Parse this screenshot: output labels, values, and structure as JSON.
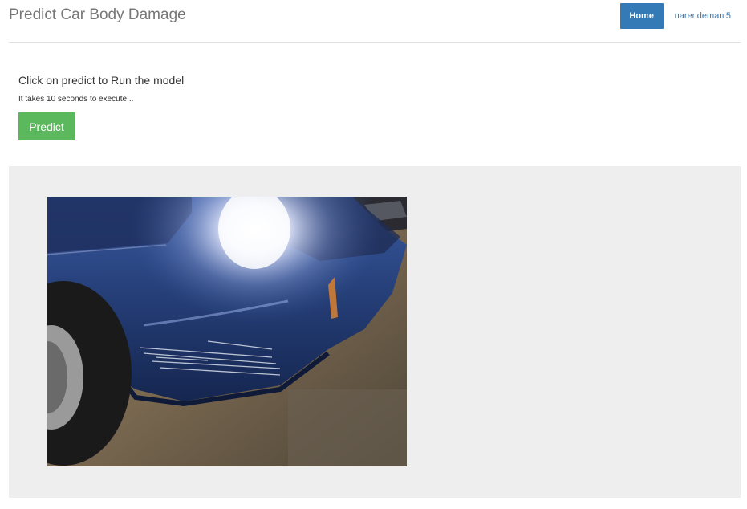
{
  "header": {
    "title": "Predict Car Body Damage",
    "nav": {
      "home_label": "Home",
      "user_label": "narendemani5"
    }
  },
  "intro": {
    "title": "Click on predict to Run the model",
    "note": "It takes 10 seconds to execute..."
  },
  "actions": {
    "predict_label": "Predict"
  },
  "colors": {
    "primary": "#337ab7",
    "success": "#5cb85c",
    "panel_bg": "#eeeeee",
    "brand_text": "#777777"
  }
}
